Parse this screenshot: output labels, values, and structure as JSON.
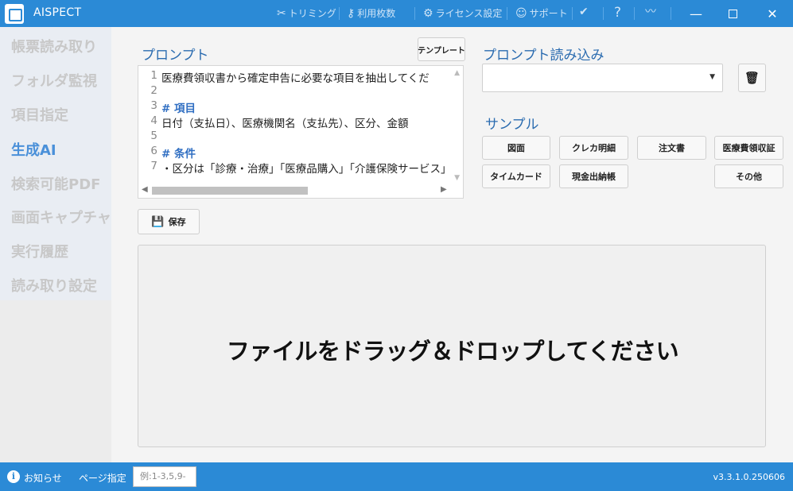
{
  "app": {
    "title": "AISPECT"
  },
  "toolbar": [
    {
      "label": "トリミング",
      "icon": "scissors-icon"
    },
    {
      "label": "利用枚数",
      "icon": "key-icon"
    },
    {
      "label": "ライセンス設定",
      "icon": "gear-icon"
    },
    {
      "label": "サポート",
      "icon": "support-icon"
    },
    {
      "label": "",
      "icon": "check-circle-icon"
    },
    {
      "label": "",
      "icon": "help-icon"
    },
    {
      "label": "",
      "icon": "activity-icon"
    }
  ],
  "sidebar": {
    "items": [
      {
        "label": "帳票読み取り"
      },
      {
        "label": "フォルダ監視"
      },
      {
        "label": "項目指定"
      },
      {
        "label": "生成AI",
        "active": true
      },
      {
        "label": "検索可能PDF"
      },
      {
        "label": "画面キャプチャ"
      },
      {
        "label": "実行履歴"
      },
      {
        "label": "読み取り設定"
      }
    ]
  },
  "prompt": {
    "title": "プロンプト",
    "template_button": "テンプレート",
    "lines": [
      {
        "num": "1",
        "text": "医療費領収書から確定申告に必要な項目を抽出してくだ"
      },
      {
        "num": "2",
        "text": ""
      },
      {
        "num": "3",
        "text": "# 項目"
      },
      {
        "num": "4",
        "text": "日付（支払日）、医療機関名（支払先）、区分、金額"
      },
      {
        "num": "5",
        "text": ""
      },
      {
        "num": "6",
        "text": "# 条件"
      },
      {
        "num": "7",
        "text": "・区分は「診療・治療」「医療品購入」「介護保険サービス」"
      }
    ],
    "save_button": "保存"
  },
  "prompt_load": {
    "title": "プロンプト読み込み",
    "selected": ""
  },
  "samples": {
    "title": "サンプル",
    "buttons": [
      "図面",
      "クレカ明細",
      "注文書",
      "医療費領収証",
      "タイムカード",
      "現金出納帳",
      "その他"
    ]
  },
  "drop_zone": {
    "text": "ファイルをドラッグ＆ドロップしてください"
  },
  "statusbar": {
    "notice": "お知らせ",
    "page_label": "ページ指定",
    "page_placeholder": "例:1-3,5,9-",
    "version": "v3.3.1.0.250606"
  },
  "colors": {
    "accent": "#2b8ad6",
    "heading": "#2b6cb0",
    "active_nav": "#4a90d9"
  }
}
